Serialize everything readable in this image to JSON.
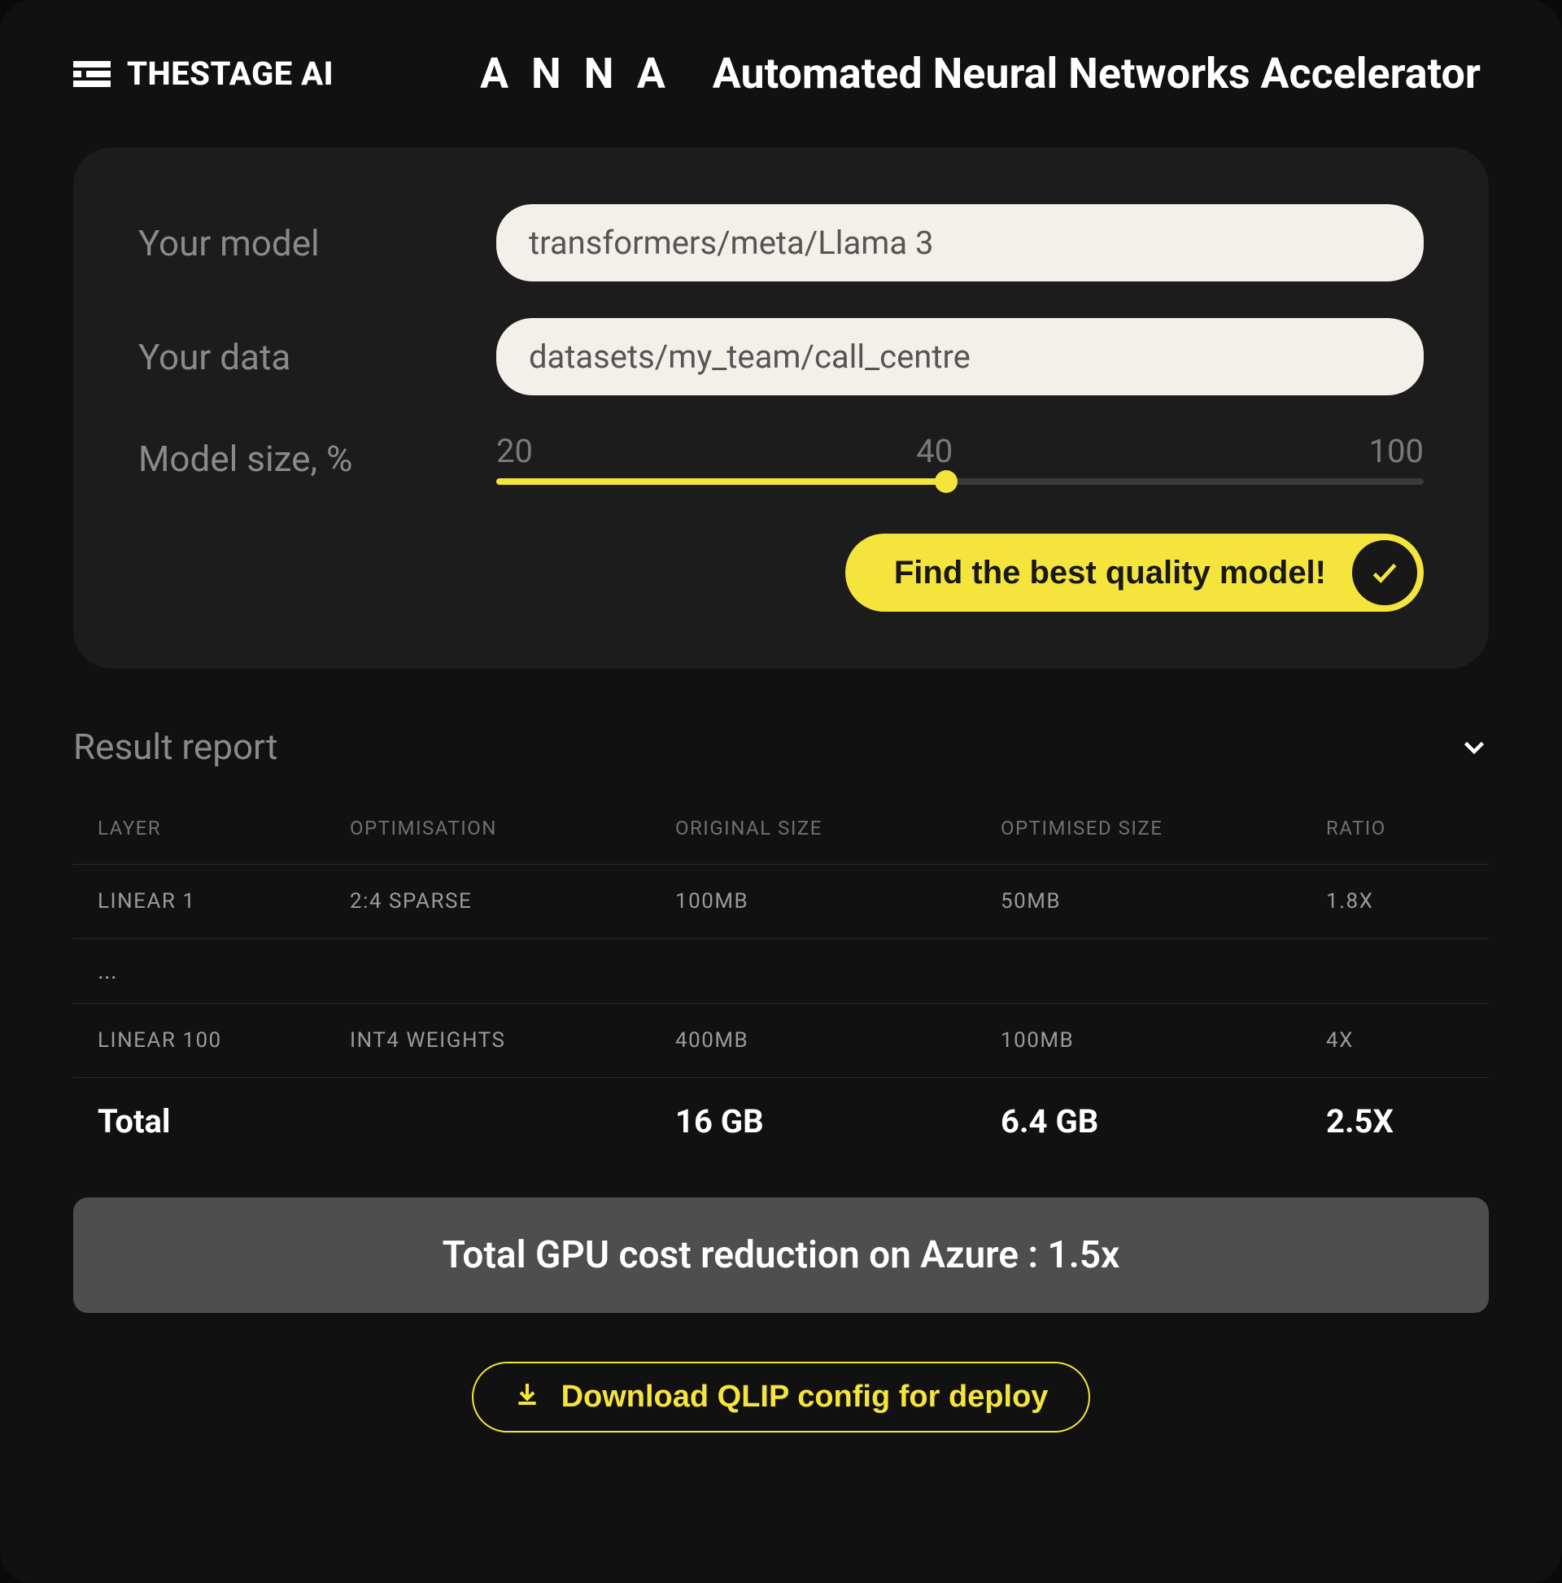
{
  "brand": "THESTAGE AI",
  "anna": {
    "word": "ANNA",
    "subtitle": "Automated Neural Networks Accelerator"
  },
  "form": {
    "model_label": "Your model",
    "model_value": "transformers/meta/Llama 3",
    "data_label": "Your data",
    "data_value": "datasets/my_team/call_centre",
    "size_label": "Model size, %",
    "slider_ticks": [
      "20",
      "40",
      "100"
    ],
    "slider_value_percent": 40,
    "cta_label": "Find the best quality model!"
  },
  "report": {
    "title": "Result report",
    "columns": [
      "LAYER",
      "OPTIMISATION",
      "ORIGINAL SIZE",
      "OPTIMISED SIZE",
      "RATIO"
    ],
    "rows": [
      {
        "layer": "LINEAR 1",
        "optimisation": "2:4 SPARSE",
        "original": "100MB",
        "optimised": "50MB",
        "ratio": "1.8X"
      },
      {
        "ellipsis": "..."
      },
      {
        "layer": "LINEAR 100",
        "optimisation": "INT4 WEIGHTS",
        "original": "400MB",
        "optimised": "100MB",
        "ratio": "4X"
      }
    ],
    "total": {
      "label": "Total",
      "original": "16 GB",
      "optimised": "6.4 GB",
      "ratio": "2.5X"
    },
    "banner": "Total GPU cost reduction on Azure : 1.5x",
    "download_label": "Download QLIP config for deploy"
  },
  "colors": {
    "accent": "#f5e43c",
    "bg": "#111111",
    "card": "#1c1c1c"
  }
}
